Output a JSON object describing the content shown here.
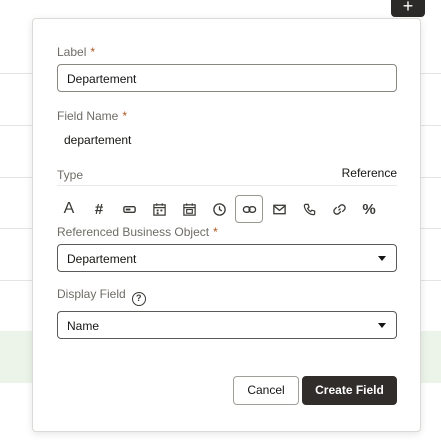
{
  "toolbar": {
    "add_glyph": "+"
  },
  "form": {
    "label": {
      "label": "Label",
      "required_mark": "*",
      "value": "Departement"
    },
    "field_name": {
      "label": "Field Name",
      "required_mark": "*",
      "value": "departement"
    },
    "type": {
      "label": "Type",
      "value": "Reference",
      "icons": [
        {
          "name": "text-type-icon",
          "glyph": "A"
        },
        {
          "name": "number-type-icon",
          "glyph": "#"
        },
        {
          "name": "boolean-type-icon",
          "glyph": ""
        },
        {
          "name": "date-type-icon",
          "glyph": ""
        },
        {
          "name": "datetime-type-icon",
          "glyph": ""
        },
        {
          "name": "time-type-icon",
          "glyph": ""
        },
        {
          "name": "reference-type-icon",
          "glyph": "",
          "selected": true
        },
        {
          "name": "email-type-icon",
          "glyph": ""
        },
        {
          "name": "phone-type-icon",
          "glyph": ""
        },
        {
          "name": "url-type-icon",
          "glyph": ""
        },
        {
          "name": "percentage-type-icon",
          "glyph": "%"
        }
      ]
    },
    "referenced_object": {
      "label": "Referenced Business Object",
      "required_mark": "*",
      "value": "Departement"
    },
    "display_field": {
      "label": "Display Field",
      "help_glyph": "?",
      "value": "Name"
    }
  },
  "actions": {
    "cancel_label": "Cancel",
    "create_label": "Create Field"
  }
}
